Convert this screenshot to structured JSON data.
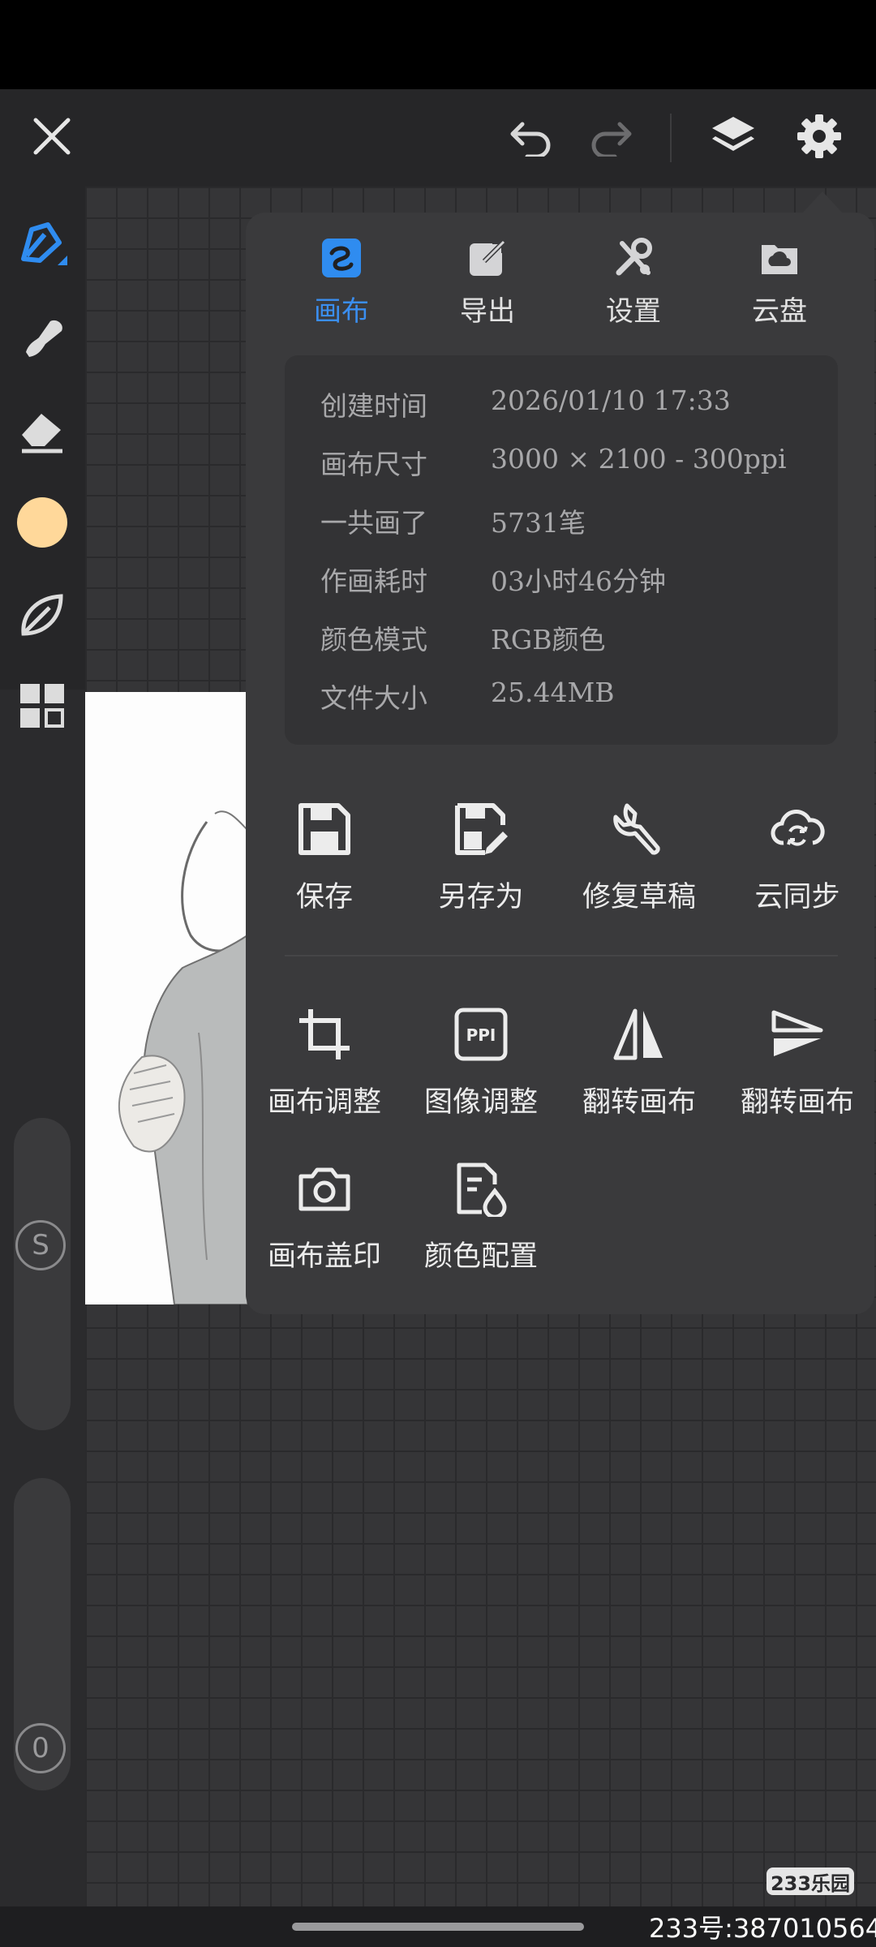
{
  "tabs": [
    {
      "label": "画布",
      "icon": "canvas-icon",
      "active": true
    },
    {
      "label": "导出",
      "icon": "export-icon",
      "active": false
    },
    {
      "label": "设置",
      "icon": "settings-tools-icon",
      "active": false
    },
    {
      "label": "云盘",
      "icon": "cloud-drive-icon",
      "active": false
    }
  ],
  "info": [
    {
      "key": "创建时间",
      "value": "2026/01/10 17:33"
    },
    {
      "key": "画布尺寸",
      "value": "3000 × 2100 - 300ppi"
    },
    {
      "key": "一共画了",
      "value": "5731笔"
    },
    {
      "key": "作画耗时",
      "value": "03小时46分钟"
    },
    {
      "key": "颜色模式",
      "value": "RGB颜色"
    },
    {
      "key": "文件大小",
      "value": "25.44MB"
    }
  ],
  "actions_row1": [
    {
      "label": "保存",
      "icon": "save-icon"
    },
    {
      "label": "另存为",
      "icon": "save-as-icon"
    },
    {
      "label": "修复草稿",
      "icon": "wrench-icon"
    },
    {
      "label": "云同步",
      "icon": "cloud-sync-icon"
    }
  ],
  "actions_row2": [
    {
      "label": "画布调整",
      "icon": "crop-icon"
    },
    {
      "label": "图像调整",
      "icon": "ppi-icon"
    },
    {
      "label": "翻转画布",
      "icon": "flip-horizontal-icon"
    },
    {
      "label": "翻转画布",
      "icon": "flip-vertical-icon"
    }
  ],
  "actions_row3": [
    {
      "label": "画布盖印",
      "icon": "camera-icon"
    },
    {
      "label": "颜色配置",
      "icon": "color-config-icon"
    }
  ],
  "sliders": {
    "size_label": "S",
    "opacity_label": "0"
  },
  "current_color": "#ffd89a",
  "accent_color": "#2f8cf0",
  "watermark": {
    "logo_text": "233乐园",
    "id_text": "233号:387010564"
  }
}
